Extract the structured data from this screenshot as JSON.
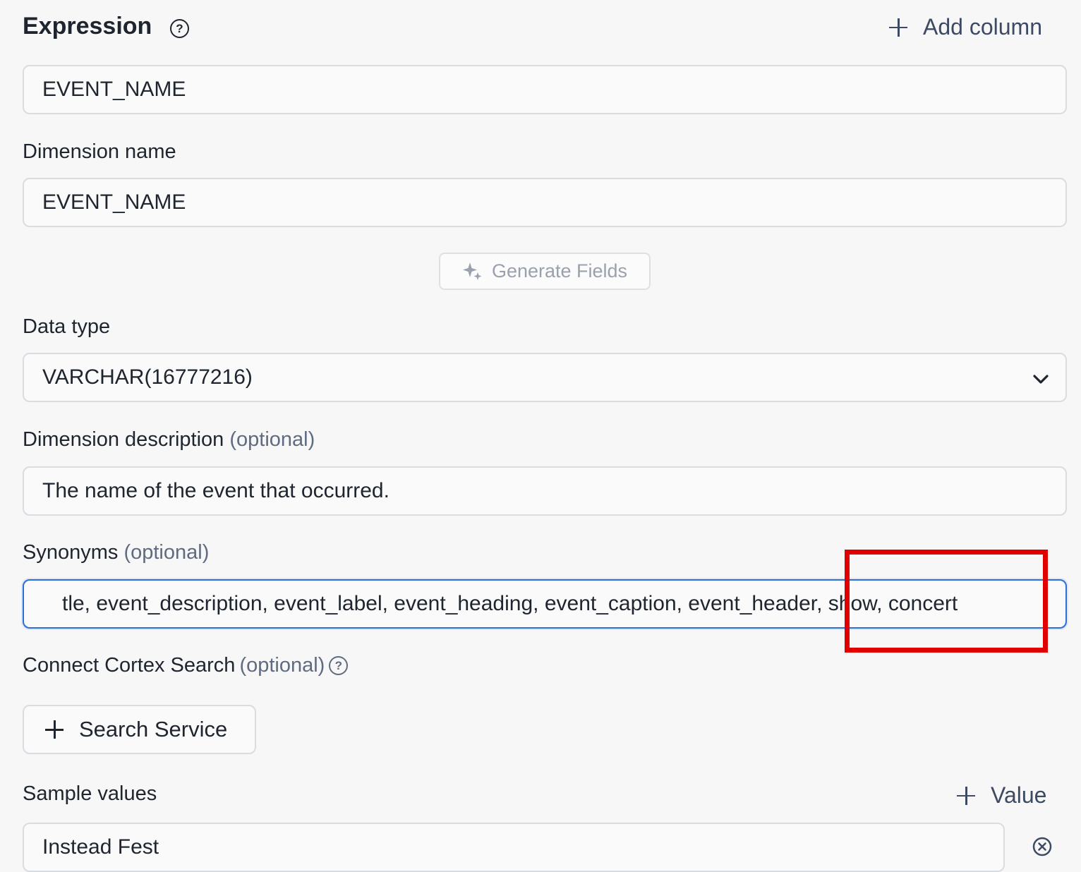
{
  "expression": {
    "title": "Expression",
    "help_icon": "question-circle-icon",
    "add_column_label": "Add column",
    "value": "EVENT_NAME"
  },
  "dimension_name": {
    "label": "Dimension name",
    "value": "EVENT_NAME"
  },
  "generate_fields": {
    "label": "Generate Fields",
    "icon": "sparkles-icon"
  },
  "data_type": {
    "label": "Data type",
    "value": "VARCHAR(16777216)",
    "icon": "chevron-down-icon"
  },
  "dimension_description": {
    "label": "Dimension description",
    "optional": "(optional)",
    "value": "The name of the event that occurred."
  },
  "synonyms": {
    "label": "Synonyms",
    "optional": "(optional)",
    "value": "tle, event_description, event_label, event_heading, event_caption, event_header, show, concert"
  },
  "cortex_search": {
    "label": "Connect Cortex Search",
    "optional": "(optional)",
    "help_icon": "question-circle-icon",
    "button_label": "Search Service"
  },
  "sample_values": {
    "label": "Sample values",
    "add_label": "Value",
    "items": [
      "Instead Fest"
    ],
    "clear_icon": "clear-circle-icon"
  },
  "colors": {
    "accent_focus": "#2c6fd6",
    "annotation_box": "#e00000",
    "muted_text": "#5f6b82"
  }
}
